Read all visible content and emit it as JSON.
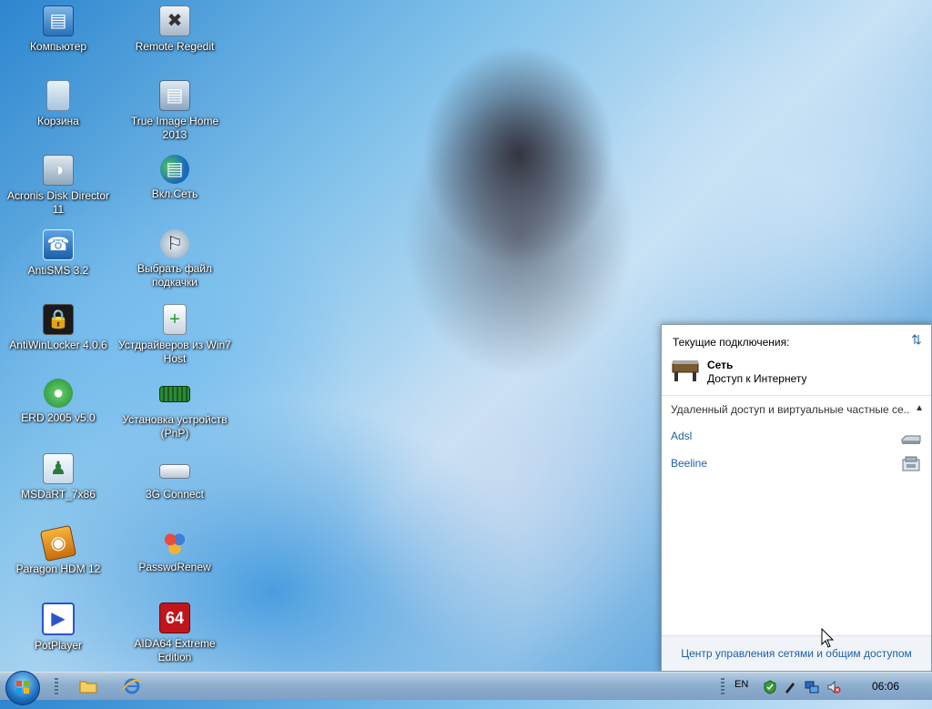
{
  "desktop": {
    "icons": [
      {
        "label": "Компьютер",
        "icon": "computer-icon"
      },
      {
        "label": "Remote Regedit",
        "icon": "regedit-icon"
      },
      {
        "label": "Корзина",
        "icon": "recycle-bin-icon"
      },
      {
        "label": "True Image Home 2013",
        "icon": "true-image-icon"
      },
      {
        "label": "Acronis Disk Director 11",
        "icon": "disk-director-icon"
      },
      {
        "label": "Вкл.Сеть",
        "icon": "network-icon"
      },
      {
        "label": "AntiSMS 3.2",
        "icon": "antisms-icon"
      },
      {
        "label": "Выбрать файл подкачки",
        "icon": "pagefile-icon"
      },
      {
        "label": "AntiWinLocker 4.0.6",
        "icon": "lock-icon"
      },
      {
        "label": "Устдрайверов из Win7 Host",
        "icon": "driver-install-icon"
      },
      {
        "label": "ERD 2005 v5.0",
        "icon": "erd-icon"
      },
      {
        "label": "Установка устройств (PnP)",
        "icon": "pnp-icon"
      },
      {
        "label": "MSDaRT_7x86",
        "icon": "msdart-icon"
      },
      {
        "label": "3G Connect",
        "icon": "usb-modem-icon"
      },
      {
        "label": "Paragon HDM 12",
        "icon": "paragon-icon"
      },
      {
        "label": "PasswdRenew",
        "icon": "users-icon"
      },
      {
        "label": "PotPlayer",
        "icon": "potplayer-icon"
      },
      {
        "label": "AIDA64 Extreme Edition",
        "icon": "aida64-icon",
        "badge": "64"
      }
    ]
  },
  "flyout": {
    "title": "Текущие подключения:",
    "network_name": "Сеть",
    "network_status": "Доступ к Интернету",
    "section_label": "Удаленный доступ и виртуальные частные се...",
    "connections": [
      {
        "name": "Adsl",
        "icon": "modem-icon"
      },
      {
        "name": "Beeline",
        "icon": "dialup-icon"
      }
    ],
    "footer_link": "Центр управления сетями и общим доступом"
  },
  "taskbar": {
    "lang": "EN",
    "clock": "06:06",
    "colors": {
      "accent": "#1c6fc0",
      "link": "#1e5fa5"
    }
  }
}
